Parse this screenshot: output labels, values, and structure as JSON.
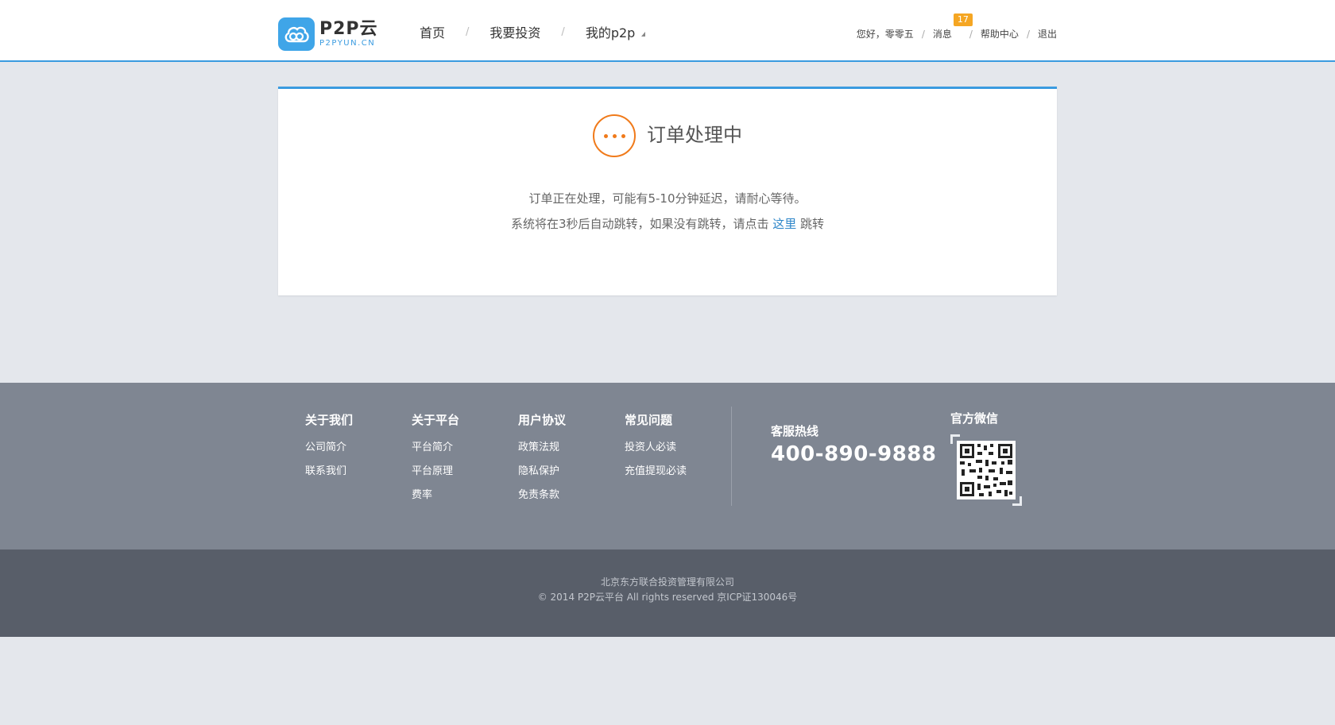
{
  "header": {
    "logo_main": "P2P云",
    "logo_sub": "P2PYUN.CN",
    "nav": [
      {
        "label": "首页"
      },
      {
        "label": "我要投资"
      },
      {
        "label": "我的p2p"
      }
    ],
    "user": {
      "greeting": "您好，零零五",
      "messages_label": "消息",
      "messages_count": "17",
      "help_label": "帮助中心",
      "logout_label": "退出"
    }
  },
  "card": {
    "title": "订单处理中",
    "line1": "订单正在处理，可能有5-10分钟延迟，请耐心等待。",
    "line2_pre": "系统将在3秒后自动跳转，如果没有跳转，请点击 ",
    "line2_link": "这里",
    "line2_post": " 跳转"
  },
  "footer": {
    "columns": [
      {
        "title": "关于我们",
        "links": [
          "公司简介",
          "联系我们"
        ]
      },
      {
        "title": "关于平台",
        "links": [
          "平台简介",
          "平台原理",
          "费率"
        ]
      },
      {
        "title": "用户协议",
        "links": [
          "政策法规",
          "隐私保护",
          "免责条款"
        ]
      },
      {
        "title": "常见问题",
        "links": [
          "投资人必读",
          "充值提现必读"
        ]
      }
    ],
    "hotline_label": "客服热线",
    "hotline_number": "400-890-9888",
    "wechat_label": "官方微信"
  },
  "copyright": {
    "company": "北京东方联合投资管理有限公司",
    "notice": "© 2014 P2P云平台 All rights reserved 京ICP证130046号"
  },
  "colors": {
    "accent": "#3a9be0",
    "status_orange": "#f07a1a",
    "badge": "#f5a623",
    "footer_bg": "#7f8692",
    "copyright_bg": "#585e69"
  }
}
